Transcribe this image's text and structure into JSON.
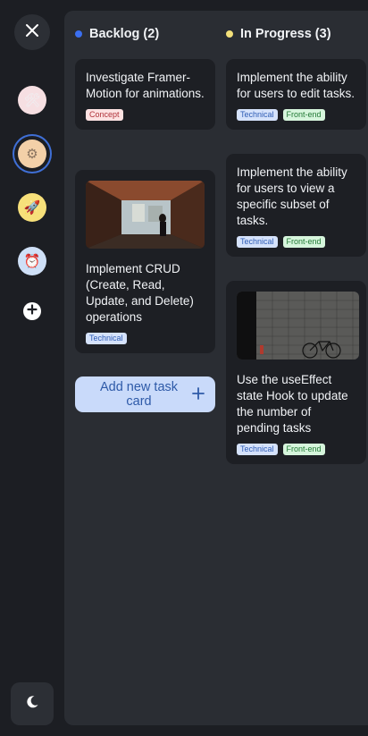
{
  "sidebar": {
    "close_icon": "close-icon",
    "boards": [
      {
        "icon": "tools-icon",
        "glyph": "🛠",
        "bg": "#f6dfe2"
      },
      {
        "icon": "gear-icon",
        "glyph": "⚙",
        "bg": "#f3d0a8",
        "selected": true
      },
      {
        "icon": "rocket-icon",
        "glyph": "🚀",
        "bg": "#f7e07a"
      },
      {
        "icon": "alarm-clock-icon",
        "glyph": "⏰",
        "bg": "#cfe0f7"
      }
    ],
    "add_board_icon": "plus-circle-icon",
    "theme_icon": "moon-icon"
  },
  "columns": [
    {
      "title": "Backlog (2)",
      "dot_color": "#3b6ff0",
      "cards": [
        {
          "title": "Investigate Framer-Motion for animations.",
          "tags": [
            "Concept"
          ]
        },
        {
          "title": "Implement CRUD (Create, Read, Update, and Delete) operations",
          "tags": [
            "Technical"
          ],
          "image": "covered-bridge-photo"
        }
      ],
      "add_label": "Add new task card",
      "add_icon": "plus-icon"
    },
    {
      "title": "In Progress (3)",
      "dot_color": "#f3e07a",
      "cards": [
        {
          "title": "Implement the ability for users to edit tasks.",
          "tags": [
            "Technical",
            "Front-end"
          ]
        },
        {
          "title": "Implement the ability for users to view a specific subset of tasks.",
          "tags": [
            "Technical",
            "Front-end"
          ]
        },
        {
          "title": "Use the useEffect state Hook to update the number of pending tasks",
          "tags": [
            "Technical",
            "Front-end"
          ],
          "image": "stone-wall-bicycle-photo"
        }
      ]
    }
  ],
  "colors": {
    "accent": "#3f6fd6",
    "tag_concept": "#fde2e2",
    "tag_technical": "#d5e2fb",
    "tag_frontend": "#d6f5dc"
  }
}
